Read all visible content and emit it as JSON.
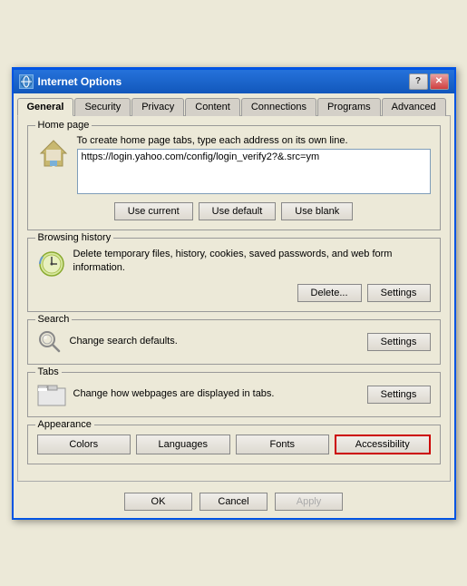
{
  "window": {
    "title": "Internet Options",
    "title_icon": "IE"
  },
  "title_buttons": {
    "help_label": "?",
    "close_label": "✕"
  },
  "tabs": [
    {
      "label": "General",
      "active": true
    },
    {
      "label": "Security"
    },
    {
      "label": "Privacy"
    },
    {
      "label": "Content"
    },
    {
      "label": "Connections"
    },
    {
      "label": "Programs"
    },
    {
      "label": "Advanced"
    }
  ],
  "sections": {
    "home_page": {
      "label": "Home page",
      "description": "To create home page tabs, type each address on its own line.",
      "url_value": "https://login.yahoo.com/config/login_verify2?&.src=ym",
      "btn_current": "Use current",
      "btn_default": "Use default",
      "btn_blank": "Use blank"
    },
    "browsing_history": {
      "label": "Browsing history",
      "description": "Delete temporary files, history, cookies, saved passwords, and web form information.",
      "btn_delete": "Delete...",
      "btn_settings": "Settings"
    },
    "search": {
      "label": "Search",
      "description": "Change search defaults.",
      "btn_settings": "Settings"
    },
    "tabs": {
      "label": "Tabs",
      "description": "Change how webpages are displayed in tabs.",
      "btn_settings": "Settings"
    },
    "appearance": {
      "label": "Appearance",
      "btn_colors": "Colors",
      "btn_languages": "Languages",
      "btn_fonts": "Fonts",
      "btn_accessibility": "Accessibility"
    }
  },
  "bottom": {
    "btn_ok": "OK",
    "btn_cancel": "Cancel",
    "btn_apply": "Apply"
  }
}
